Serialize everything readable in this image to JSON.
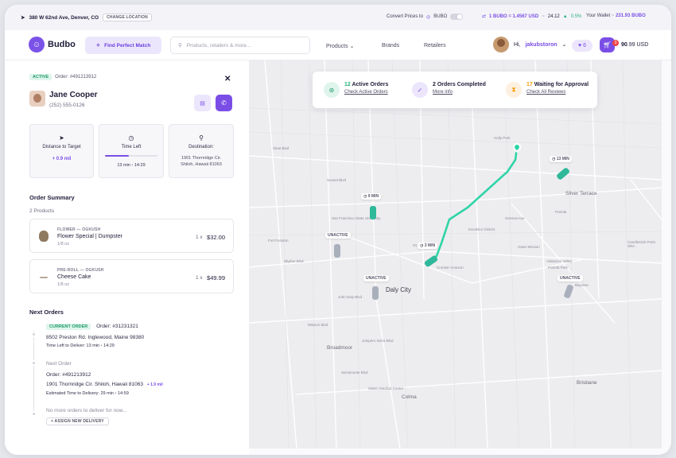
{
  "colors": {
    "accent": "#7a4ee6",
    "route": "#2fd4a6",
    "active_green": "#1f9d6b",
    "waiting": "#f59e0b"
  },
  "topbar": {
    "location": "380 W 62nd Ave, Denver, CO",
    "change_location": "CHANGE LOCATION",
    "convert_label": "Convert Prices to",
    "convert_currency": "BUBO",
    "rate": "1 BUBO = 1.4567 USD",
    "rate_value": "24.12",
    "rate_change": "0.5%",
    "wallet_label": "Your Wallet",
    "wallet_value": "231.93 BUBO"
  },
  "navbar": {
    "brand": "Budbo",
    "match_button": "Find Perfect Match",
    "search_placeholder": "Products, retailers & more...",
    "links": [
      "Products",
      "Brands",
      "Retailers"
    ],
    "greeting": "Hi,",
    "username": "jakubstoron",
    "favorites_count": "6",
    "cart_count": "3",
    "cart_total_int": "90",
    "cart_total_dec": ".99",
    "cart_currency": "USD"
  },
  "order": {
    "status": "ACTIVE",
    "order_number": "Order: #491213912",
    "customer_name": "Jane Cooper",
    "customer_phone": "(252) 555-0126",
    "stats": {
      "distance_label": "Distance to Target",
      "distance_value": "0.9 mil",
      "time_label": "Time Left",
      "time_progress": 0.45,
      "time_minutes": "13 min",
      "time_clock": "14:29",
      "destination_label": "Destination:",
      "destination_line1": "1901 Thornridge Cir.",
      "destination_line2": "Shiloh, Hawaii 81063"
    }
  },
  "summary": {
    "title": "Order Summary",
    "count": "2 Products",
    "products": [
      {
        "category": "FLOWER",
        "brand": "OGKUSH",
        "name": "Flower Special | Dumpster",
        "size": "1/8 oz",
        "qty": "1 x",
        "price": "$32.00"
      },
      {
        "category": "PRE-ROLL",
        "brand": "OGKUSH",
        "name": "Cheese Cake",
        "size": "1/8 oz",
        "qty": "1 x",
        "price": "$49.99"
      }
    ]
  },
  "next_orders": {
    "title": "Next Orders",
    "current_tag": "CURRENT ORDER",
    "current_order": "Order: #31231321",
    "current_address": "8502 Preston Rd. Inglewood, Maine 98380",
    "current_time_label": "Time Left to Deliver:",
    "current_time_min": "13 min",
    "current_time_clock": "14:29",
    "next_label": "Next Order",
    "next_order": "Order: #491213912",
    "next_address": "1901 Thornridge Cir. Shiloh, Hawaii 81063",
    "next_distance": "1.9 mil",
    "next_time_label": "Estimated Time to Delivery:",
    "next_time_min": "29 min",
    "next_time_clock": "14:59",
    "no_more": "No more orders  to deliver for now...",
    "assign_button": "ASSIGN NEW DELIVERY"
  },
  "map": {
    "active_count": "12",
    "active_label": "Active Orders",
    "active_link": "Check Active Orders",
    "completed_label": "2 Orders Completed",
    "completed_link": "More info",
    "waiting_count": "17",
    "waiting_label": "Waiting for Approval",
    "waiting_link": "Check All Reviews",
    "places": [
      "Daly City",
      "Broadmoor",
      "Colma",
      "Brisbane",
      "Silver Terrace",
      "Visitacion Valley",
      "Candlestick Point SRA",
      "Bayview",
      "Portola",
      "Excelsior District",
      "Sunset Blvd",
      "San Francisco State University",
      "Fort Funston",
      "Ocean View",
      "Outer Mission",
      "Crocker-Amazon",
      "Sloat Blvd",
      "Skyline Blvd",
      "John Daly Blvd",
      "Mission Blvd",
      "Junipero Serra Blvd",
      "Geneva Ave",
      "Serramonte Blvd",
      "Salem Medical Center",
      "Holly Park",
      "Portola Park"
    ],
    "time_pills": [
      "9 MIN",
      "3 MIN",
      "13 MIN"
    ],
    "inactive_label": "UNACTIVE"
  }
}
